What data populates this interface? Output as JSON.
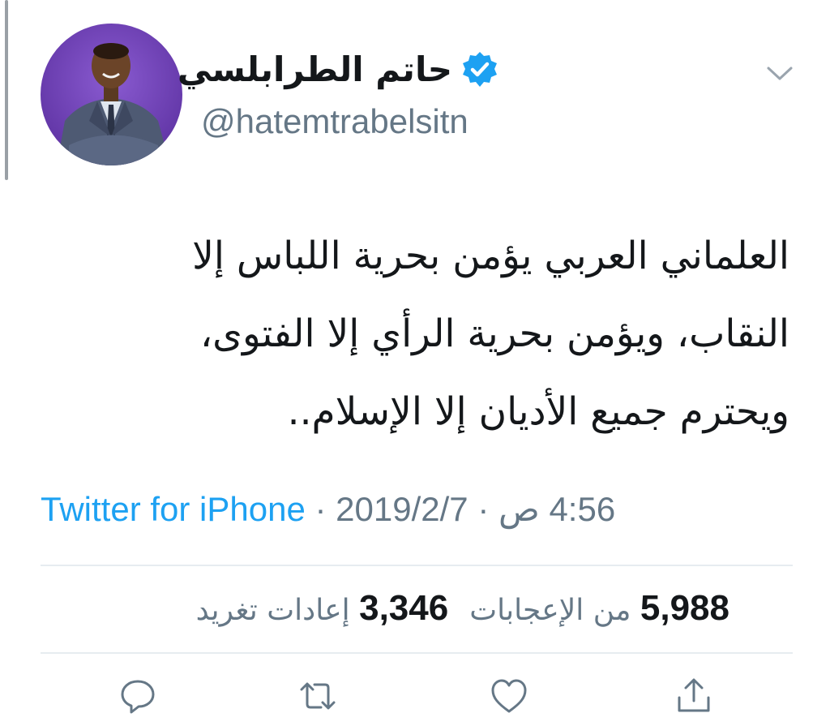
{
  "user": {
    "display_name": "حاتم الطرابلسي",
    "handle": "@hatemtrabelsitn",
    "verified": true,
    "avatar_icon": "profile-photo-man-in-suit"
  },
  "tweet": {
    "text": "العلماني العربي يؤمن بحرية اللباس إلا\nالنقاب، ويؤمن بحرية الرأي إلا الفتوى،\nويحترم جميع الأديان إلا الإسلام.."
  },
  "meta": {
    "time": "4:56 ص",
    "separator": "·",
    "date": "2019/2/7",
    "source": "Twitter for iPhone"
  },
  "stats": {
    "likes_count": "5,988",
    "likes_label": "من الإعجابات",
    "retweets_count": "3,346",
    "retweets_label": "إعادات تغريد"
  },
  "actions": [
    {
      "name": "reply",
      "icon": "reply-icon"
    },
    {
      "name": "retweet",
      "icon": "retweet-icon"
    },
    {
      "name": "like",
      "icon": "heart-icon"
    },
    {
      "name": "share",
      "icon": "share-icon"
    }
  ],
  "colors": {
    "link": "#1da1f2",
    "muted": "#657786",
    "text": "#14171a",
    "divider": "#e6ecf0",
    "verified": "#1da1f2",
    "avatar_bg": "#6a3fb3"
  }
}
